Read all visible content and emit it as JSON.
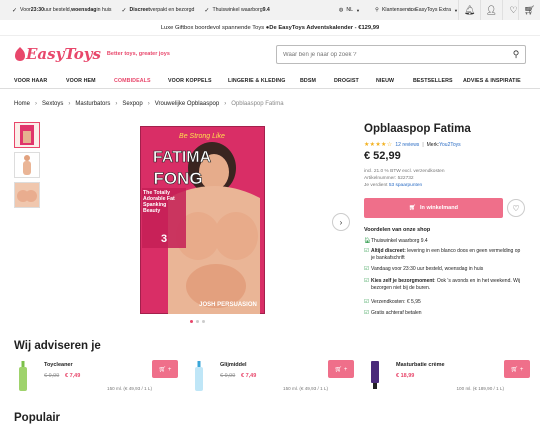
{
  "topbar": {
    "usps": [
      {
        "bold": "23:30",
        "pre": "Voor ",
        "post": " uur besteld, ",
        "bold2": "woensdag",
        "post2": " in huis"
      },
      {
        "bold": "Discreet",
        "pre": "",
        "post": " verpakt en bezorgd",
        "bold2": "",
        "post2": ""
      },
      {
        "bold": "",
        "pre": "Thuiswinkel waarborg ",
        "post": "",
        "bold2": "9.4",
        "post2": ""
      }
    ],
    "language": "NL",
    "service": "Klantenservice",
    "extra": "EasyToys Extra"
  },
  "promo": {
    "text": "Luxe Giftbox boordevol spannende Toys ● ",
    "bold": "De EasyToys Adventskalender - €129,99"
  },
  "logo": {
    "text": "EasyToys",
    "tagline": "Better toys, greater joys"
  },
  "search": {
    "placeholder": "Waar ben je naar op zoek ?"
  },
  "nav": [
    "VOOR HAAR",
    "VOOR HEM",
    "COMBIDEALS",
    "VOOR KOPPELS",
    "LINGERIE & KLEDING",
    "BDSM",
    "DROGIST",
    "NIEUW",
    "BESTSELLERS",
    "ADVIES & INSPIRATIE"
  ],
  "breadcrumb": [
    "Home",
    "Sextoys",
    "Masturbators",
    "Sexpop",
    "Vrouwelijke Opblaaspop",
    "Opblaaspop Fatima"
  ],
  "product": {
    "title": "Opblaaspop Fatima",
    "stars": "★★★★☆",
    "reviews": "12 reviews",
    "brand_label": "Merk: ",
    "brand": "You2Toys",
    "price": "€ 52,99",
    "vat": "incl. 21.0 % BTW excl. verzendkosten",
    "sku": "Artikelnummer:  522732",
    "points_pre": "Je verdient ",
    "points": "53 spaarpunten",
    "buy_label": "In winkelmand",
    "box_text_1": "Be Strong Like",
    "box_text_2": "FATIMA",
    "box_text_3": "FONG",
    "box_text_4": "The Totally Adorable Fat Spanking Beauty",
    "box_text_5": "3",
    "box_text_6": "JOSH PERSUASION"
  },
  "advantages": {
    "title": "Voordelen van onze shop",
    "items": [
      {
        "icon": "thuiswinkel-icon",
        "bold": "",
        "text": "Thuiswinkel waarborg 9.4"
      },
      {
        "icon": "check-icon",
        "bold": "Altijd discreet:",
        "text": " levering in een blanco doos en geen vermelding op je bankafschrift"
      },
      {
        "icon": "check-icon",
        "bold": "",
        "text": "Vandaag voor 23:30 uur besteld, woensdag in huis"
      },
      {
        "icon": "check-icon",
        "bold": "Kies zelf je bezorgmoment",
        "text": ": Ook 's avonds en in het weekend. Wij bezorgen niet bij de buren."
      },
      {
        "icon": "check-icon",
        "bold": "",
        "text": "Verzendkosten: € 5,95"
      },
      {
        "icon": "check-icon",
        "bold": "",
        "text": "Gratis achteraf betalen"
      }
    ]
  },
  "recommend": {
    "title": "Wij adviseren je",
    "items": [
      {
        "name": "Toycleaner",
        "old": "€ 9,99",
        "new": "€ 7,49",
        "unit": "150 ml. (€ 49,93 / 1 L)"
      },
      {
        "name": "Glijmiddel",
        "old": "€ 9,99",
        "new": "€ 7,49",
        "unit": "150 ml. (€ 49,93 / 1 L)"
      },
      {
        "name": "Masturbatie crème",
        "old": "",
        "new": "€ 18,99",
        "unit": "100 ml. (€ 189,90 / 1 L)"
      }
    ]
  },
  "popular": {
    "title": "Populair"
  },
  "colors": {
    "brand": "#e8476b",
    "button": "#ef6f8a",
    "star": "#f2b01e",
    "link": "#2a6cc4",
    "check": "#2e9b4c"
  }
}
